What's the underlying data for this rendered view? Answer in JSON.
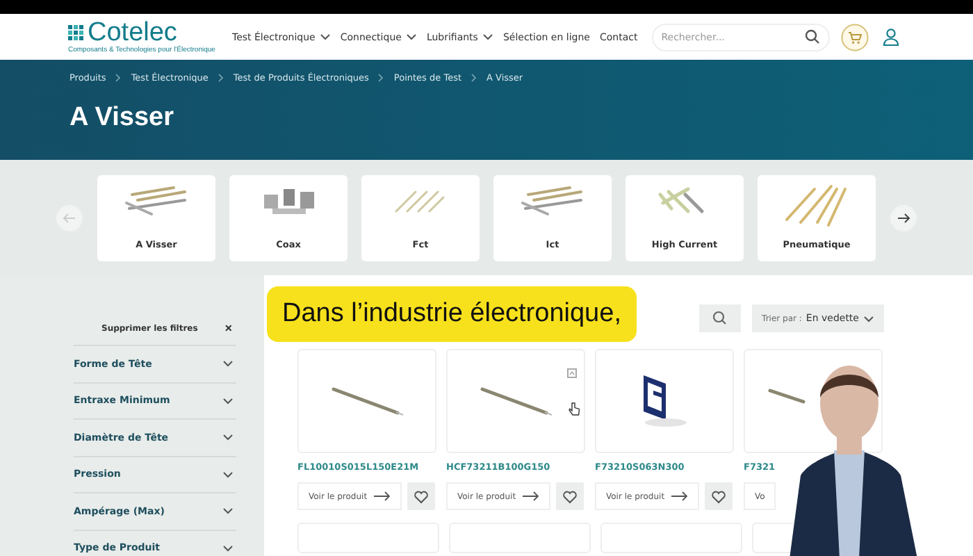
{
  "header": {
    "logo": {
      "name": "Cotelec",
      "tagline": "Composants & Technologies pour l'Électronique"
    },
    "nav": [
      {
        "label": "Test Électronique",
        "dropdown": true
      },
      {
        "label": "Connectique",
        "dropdown": true
      },
      {
        "label": "Lubrifiants",
        "dropdown": true
      },
      {
        "label": "Sélection en ligne",
        "dropdown": false
      },
      {
        "label": "Contact",
        "dropdown": false
      }
    ],
    "search": {
      "placeholder": "Rechercher..."
    }
  },
  "breadcrumb": [
    "Produits",
    "Test Électronique",
    "Test de Produits Électroniques",
    "Pointes de Test",
    "A Visser"
  ],
  "page_title": "A Visser",
  "categories": {
    "prev": {
      "disabled": true
    },
    "next": {
      "disabled": false
    },
    "items": [
      {
        "label": "A Visser",
        "kind": "bundle"
      },
      {
        "label": "Coax",
        "kind": "blocks"
      },
      {
        "label": "Fct",
        "kind": "thin"
      },
      {
        "label": "Ict",
        "kind": "bundle"
      },
      {
        "label": "High Current",
        "kind": "thick"
      },
      {
        "label": "Pneumatique",
        "kind": "long"
      }
    ]
  },
  "filters": {
    "clear": "Supprimer les filtres",
    "close": "×",
    "items": [
      "Forme de Tête",
      "Entraxe Minimum",
      "Diamètre de Tête",
      "Pression",
      "Ampérage (Max)",
      "Type de Produit"
    ]
  },
  "sort": {
    "label": "Trier par :",
    "value": "En vedette"
  },
  "products": [
    {
      "code": "FL10010S015L150E21M",
      "button": "Voir le produit",
      "kind": "probe",
      "hovered": false
    },
    {
      "code": "HCF73211B100G150",
      "button": "Voir le produit",
      "kind": "probe",
      "hovered": true
    },
    {
      "code": "F73210S063N300",
      "button": "Voir le produit",
      "kind": "logo",
      "hovered": false
    },
    {
      "code": "F7321",
      "button": "Vo",
      "kind": "probe_stub",
      "hovered": false
    }
  ],
  "caption": "Dans l’industrie électronique,"
}
